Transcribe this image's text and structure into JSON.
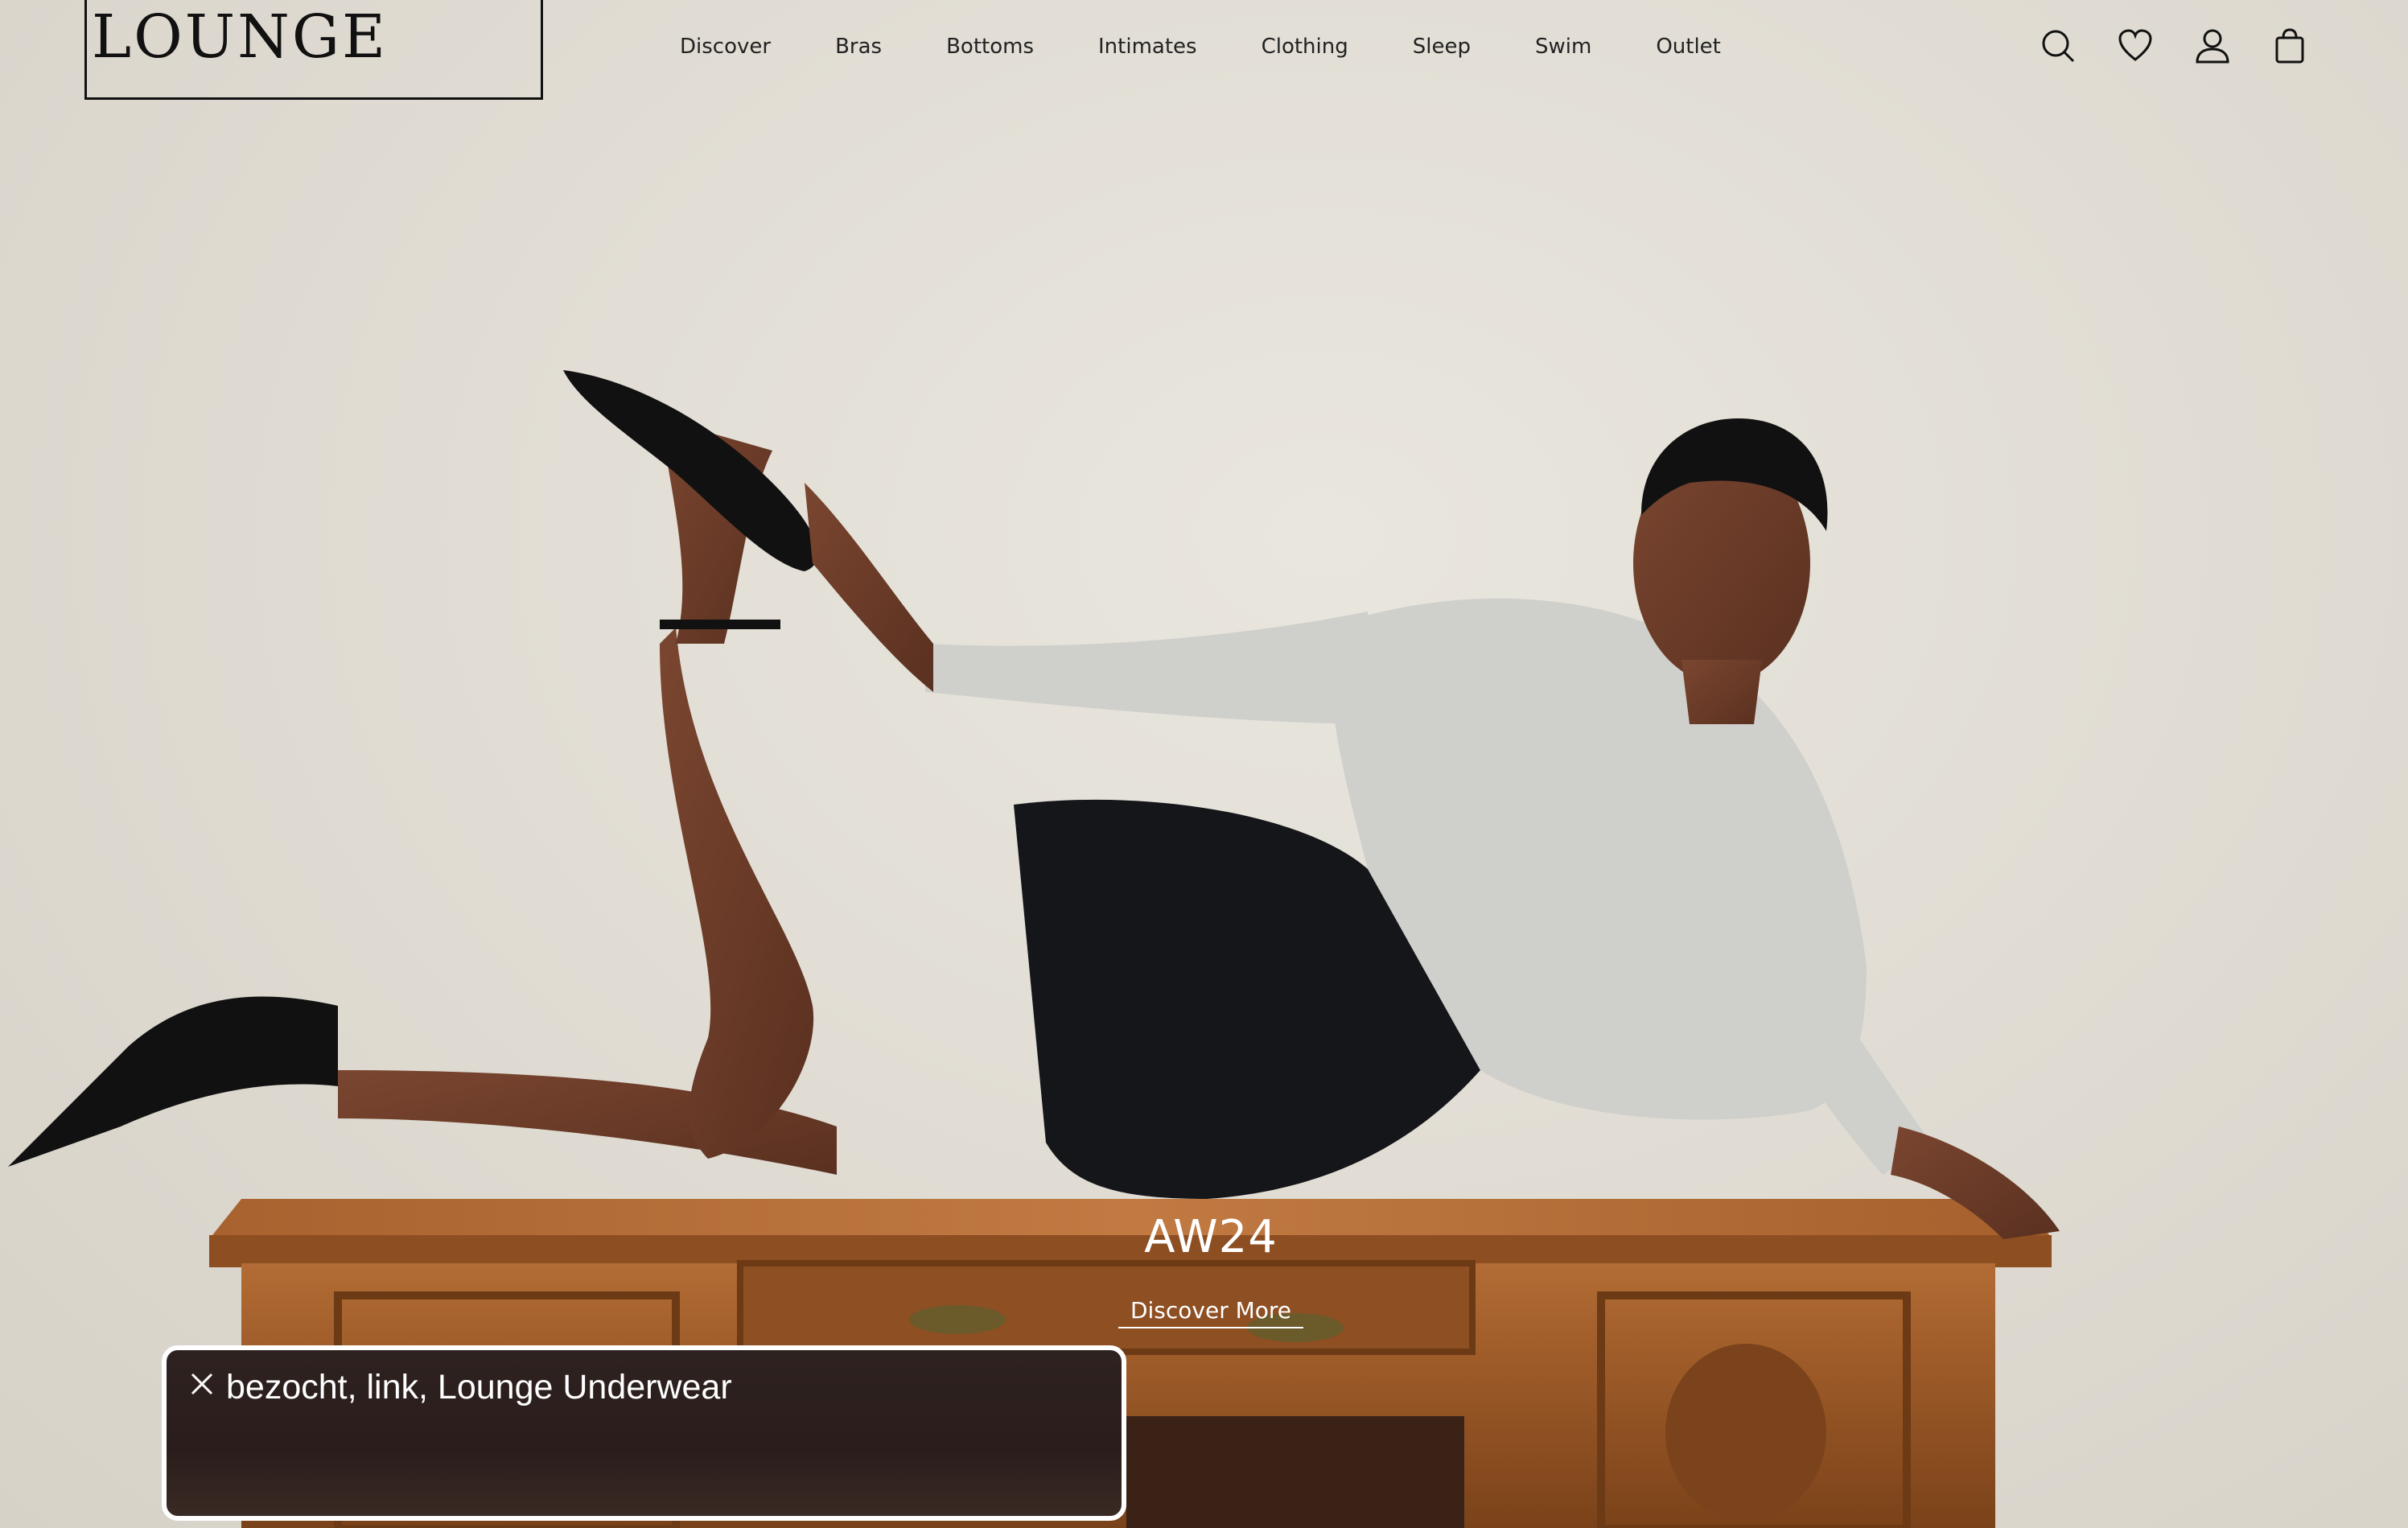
{
  "header": {
    "logo": "LOUNGE",
    "nav": [
      {
        "label": "Discover"
      },
      {
        "label": "Bras"
      },
      {
        "label": "Bottoms"
      },
      {
        "label": "Intimates"
      },
      {
        "label": "Clothing"
      },
      {
        "label": "Sleep"
      },
      {
        "label": "Swim"
      },
      {
        "label": "Outlet"
      }
    ],
    "icons": [
      "search-icon",
      "heart-icon",
      "account-icon",
      "bag-icon"
    ]
  },
  "hero": {
    "title": "AW24",
    "cta": "Discover More"
  },
  "toast": {
    "text": "bezocht, link, Lounge Underwear",
    "icon": "close-icon"
  },
  "colors": {
    "background": "#e3dfd6",
    "text": "#222222",
    "toast_bg": "#2c201d"
  }
}
